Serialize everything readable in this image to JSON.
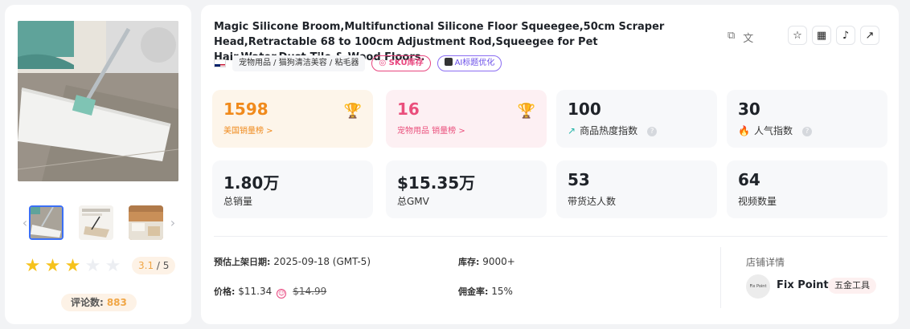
{
  "product": {
    "title": "Magic Silicone Broom,Multifunctional Silicone Floor Squeegee,50cm Scraper Head,Retractable 68 to 100cm Adjustment Rod,Squeegee for Pet Hair,Water,Dust,Tile & Wood Floors.",
    "category": "宠物用品 / 猫狗清洁美容 / 粘毛器",
    "sku_tag": "SKU库存",
    "ai_tag": "AI标题优化",
    "country_flag": "us-flag-icon"
  },
  "rating": {
    "stars": 3,
    "max": 5,
    "text_value": "3.1",
    "text_sep": " / ",
    "text_max": "5",
    "review_label": "评论数:",
    "review_count": "883"
  },
  "stats": {
    "us_rank": {
      "value": "1598",
      "label": "美国销量榜 >"
    },
    "cat_rank": {
      "value": "16",
      "label": "宠物用品 销量榜 >"
    },
    "heat": {
      "value": "100",
      "label": "商品热度指数",
      "help": "?"
    },
    "popularity": {
      "value": "30",
      "label": "人气指数",
      "help": "?"
    },
    "total_sales": {
      "value": "1.80万",
      "label": "总销量"
    },
    "total_gmv": {
      "value": "$15.35万",
      "label": "总GMV"
    },
    "influencers": {
      "value": "53",
      "label": "带货达人数"
    },
    "videos": {
      "value": "64",
      "label": "视频数量"
    }
  },
  "info": {
    "launch_label": "预估上架日期:",
    "launch_value": "2025-09-18 (GMT-5)",
    "stock_label": "库存:",
    "stock_value": "9000+",
    "price_label": "价格:",
    "price_value": "$11.34",
    "price_original": "$14.99",
    "commission_label": "佣金率:",
    "commission_value": "15%"
  },
  "store": {
    "title": "店铺详情",
    "logo_text": "Fix Point",
    "name": "Fix Point",
    "tag": "五金工具"
  },
  "colors": {
    "accent_orange": "#f08a1c",
    "accent_pink": "#ea4f7c",
    "star": "#f6c21c"
  }
}
